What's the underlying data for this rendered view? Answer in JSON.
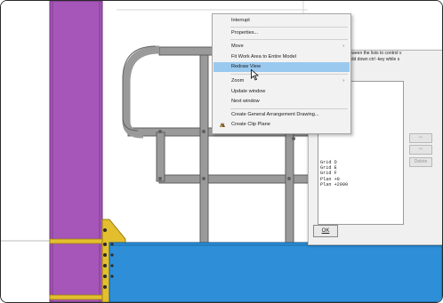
{
  "context_menu": {
    "items": [
      {
        "label": "Interrupt"
      },
      {
        "label": "Properties..."
      },
      {
        "label": "Move",
        "submenu": true
      },
      {
        "label": "Fit Work Area to Entire Model"
      },
      {
        "label": "Redraw View",
        "highlighted": true
      },
      {
        "label": "Zoom",
        "submenu": true
      },
      {
        "label": "Update window"
      },
      {
        "label": "Next window"
      },
      {
        "label": "Create General Arrangement Drawing..."
      },
      {
        "label": "Create Clip Plane",
        "icon": "clip-plane-icon"
      }
    ],
    "submenu_arrow": "›"
  },
  "views_dialog": {
    "help_text": "ove views between the lists to control v\ntiple views, hold down ctrl -key while s",
    "list_items": [
      "Grid D",
      "Grid E",
      "Grid F",
      "Plan +0",
      "Plan +2090"
    ],
    "buttons": {
      "move_right": "⇨",
      "move_left": "⇦",
      "delete": "Delete",
      "ok": "OK"
    }
  },
  "colors": {
    "column_purple": "#a556b8",
    "beam_blue": "#2e8fd8",
    "plate_yellow": "#e3bf2e",
    "railing_gray": "#8e8e8e",
    "menu_highlight": "#99c9ef"
  }
}
